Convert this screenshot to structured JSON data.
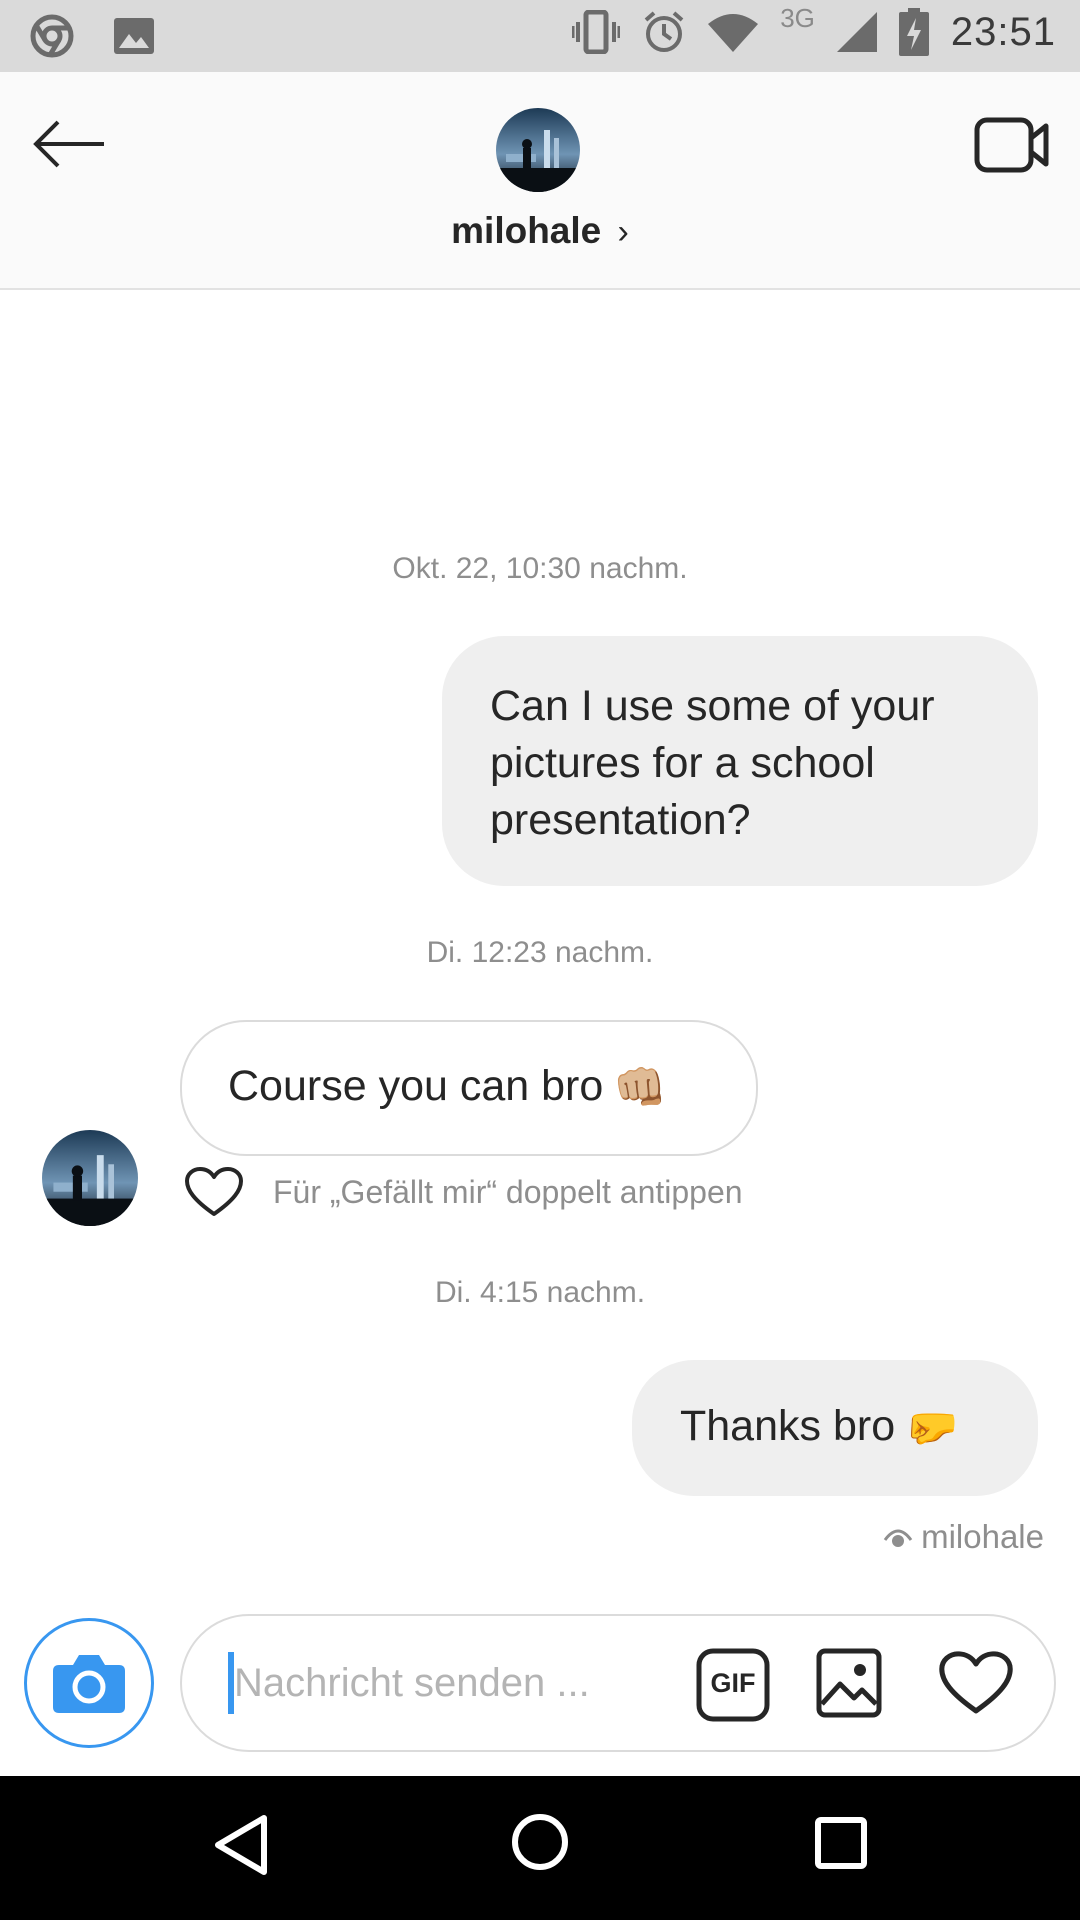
{
  "status_bar": {
    "time": "23:51",
    "network": "3G",
    "icons": [
      "chrome-icon",
      "gallery-icon",
      "vibrate-icon",
      "alarm-icon",
      "wifi-icon",
      "signal-icon",
      "battery-charging-icon"
    ]
  },
  "header": {
    "username": "milohale",
    "chevron": "›",
    "back_icon": "arrow-left-icon",
    "video_icon": "video-camera-icon"
  },
  "conversation": {
    "timestamp_1": "Okt. 22, 10:30 nachm.",
    "msg_out_1": "Can I use some of your pictures for a school presentation?",
    "timestamp_2": "Di. 12:23 nachm.",
    "msg_in_1": "Course you can bro",
    "msg_in_1_emoji": "👊🏼",
    "like_hint": "Für „Gefällt mir“ doppelt antippen",
    "timestamp_3": "Di. 4:15 nachm.",
    "msg_out_2": "Thanks bro",
    "msg_out_2_emoji": "🤛",
    "seen_by": "milohale"
  },
  "composer": {
    "placeholder": "Nachricht senden ...",
    "value": "",
    "gif_label": "GIF"
  },
  "colors": {
    "accent": "#3897f0",
    "bubble_out": "#efefef",
    "muted_text": "#8e8e8e"
  }
}
